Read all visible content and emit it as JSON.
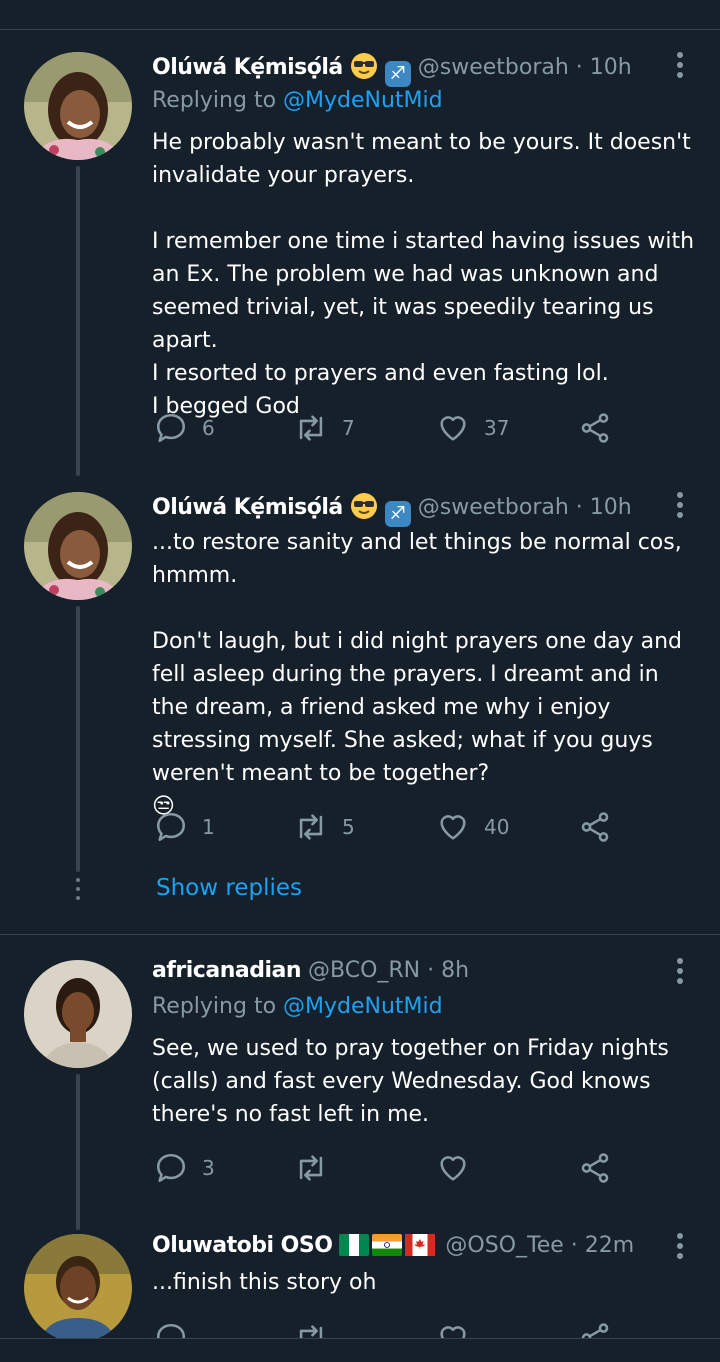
{
  "tweets": [
    {
      "name": "Olúwá Kẹ́misọ́lá",
      "handle": "@sweetborah",
      "time": "10h",
      "replying_prefix": "Replying to",
      "replying_to": "@MydeNutMid",
      "body": "He probably wasn't meant to be yours. It doesn't invalidate your prayers.\n\nI remember one time i started having issues with an Ex. The problem we had was unknown and seemed trivial, yet, it was speedily tearing us apart.\nI resorted to prayers and even fasting lol.\nI begged God",
      "replies": "6",
      "retweets": "7",
      "likes": "37"
    },
    {
      "name": "Olúwá Kẹ́misọ́lá",
      "handle": "@sweetborah",
      "time": "10h",
      "body": "...to restore sanity and let things be normal cos, hmmm.\n\nDon't laugh, but i did night prayers one day and fell asleep during the prayers. I dreamt and in the dream, a friend asked me why i enjoy stressing myself. She asked; what if you guys weren't meant to be together?\n😒",
      "replies": "1",
      "retweets": "5",
      "likes": "40"
    },
    {
      "name": "africanadian",
      "handle": "@BCO_RN",
      "time": "8h",
      "replying_prefix": "Replying to",
      "replying_to": "@MydeNutMid",
      "body": "See, we used to pray together on Friday nights (calls) and fast every Wednesday. God knows there's no fast left in me.",
      "replies": "3",
      "retweets": "",
      "likes": ""
    },
    {
      "name": "Oluwatobi OSO",
      "handle": "@OSO_Tee",
      "time": "22m",
      "body": "...finish this story oh"
    }
  ],
  "show_replies_label": "Show replies",
  "separator": " · ",
  "icons": {
    "reply": "reply-icon",
    "retweet": "retweet-icon",
    "like": "heart-icon",
    "share": "share-icon",
    "more": "more-vertical-icon"
  },
  "colors": {
    "background": "#15202b",
    "secondary_text": "#8899a6",
    "link": "#1da1f2",
    "divider": "#38444d"
  }
}
